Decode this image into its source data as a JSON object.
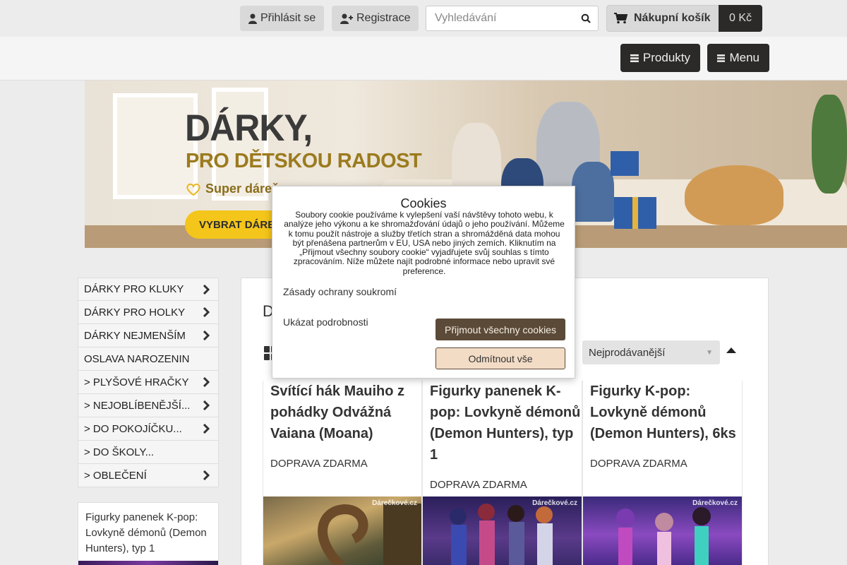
{
  "header": {
    "login_label": "Přihlásit se",
    "register_label": "Registrace",
    "search_placeholder": "Vyhledávání",
    "cart_label": "Nákupní košík",
    "cart_total": "0 Kč",
    "icons": [
      "user-icon",
      "user-plus-icon",
      "search-icon",
      "cart-icon"
    ]
  },
  "nav": {
    "products_label": "Produkty",
    "menu_label": "Menu",
    "icons": [
      "bars-icon"
    ]
  },
  "banner": {
    "title": "DÁRKY,",
    "subtitle": "PRO DĚTSKOU RADOST",
    "line3": "Super dáreč",
    "cta": "VYBRAT DÁREK"
  },
  "sidebar": {
    "categories": [
      {
        "label": "DÁRKY PRO KLUKY",
        "has_children": true
      },
      {
        "label": "DÁRKY PRO HOLKY",
        "has_children": true
      },
      {
        "label": "DÁRKY NEJMENŠÍM",
        "has_children": true
      },
      {
        "label": "OSLAVA NAROZENIN",
        "has_children": false
      },
      {
        "label": "> PLYŠOVÉ HRAČKY",
        "has_children": true
      },
      {
        "label": "> NEJOBLÍBENĚJŠÍ...",
        "has_children": true
      },
      {
        "label": "> DO POKOJÍČKU...",
        "has_children": true
      },
      {
        "label": "> DO ŠKOLY...",
        "has_children": false
      },
      {
        "label": "> OBLEČENÍ",
        "has_children": true
      }
    ],
    "promo_title": "Figurky panenek K-pop: Lovkyně démonů (Demon Hunters), typ 1"
  },
  "main": {
    "heading": "D",
    "sort_selected": "Nejprodávanější",
    "products": [
      {
        "title": "Svítící hák Mauiho z pohádky Odvážná Vaiana (Moana)",
        "shipping": "DOPRAVA ZDARMA",
        "watermark": "Dárečkové.cz"
      },
      {
        "title": "Figurky panenek K-pop: Lovkyně démonů (Demon Hunters), typ 1",
        "shipping": "DOPRAVA ZDARMA",
        "watermark": "Dárečkové.cz"
      },
      {
        "title": "Figurky K-pop: Lovkyně démonů (Demon Hunters), 6ks",
        "shipping": "DOPRAVA ZDARMA",
        "watermark": "Dárečkové.cz"
      }
    ]
  },
  "cookie": {
    "title": "Cookies",
    "text": "Soubory cookie používáme k vylepšení vaší návštěvy tohoto webu, k analýze jeho výkonu a ke shromažďování údajů o jeho používání. Můžeme k tomu použít nástroje a služby třetích stran a shromážděná data mohou být přenášena partnerům v EU, USA nebo jiných zemích. Kliknutím na „Přijmout všechny soubory cookie“ vyjadřujete svůj souhlas s tímto zpracováním. Níže můžete najít podrobné informace nebo upravit své preference.",
    "privacy_link": "Zásady ochrany soukromí",
    "details_link": "Ukázat podrobnosti",
    "accept_label": "Přijmout všechny cookies",
    "reject_label": "Odmítnout vše"
  },
  "colors": {
    "dark_button": "#2b2a28",
    "accept_button": "#5b4a38",
    "reject_button": "#f3dcc6",
    "banner_cta": "#f4c51a"
  }
}
